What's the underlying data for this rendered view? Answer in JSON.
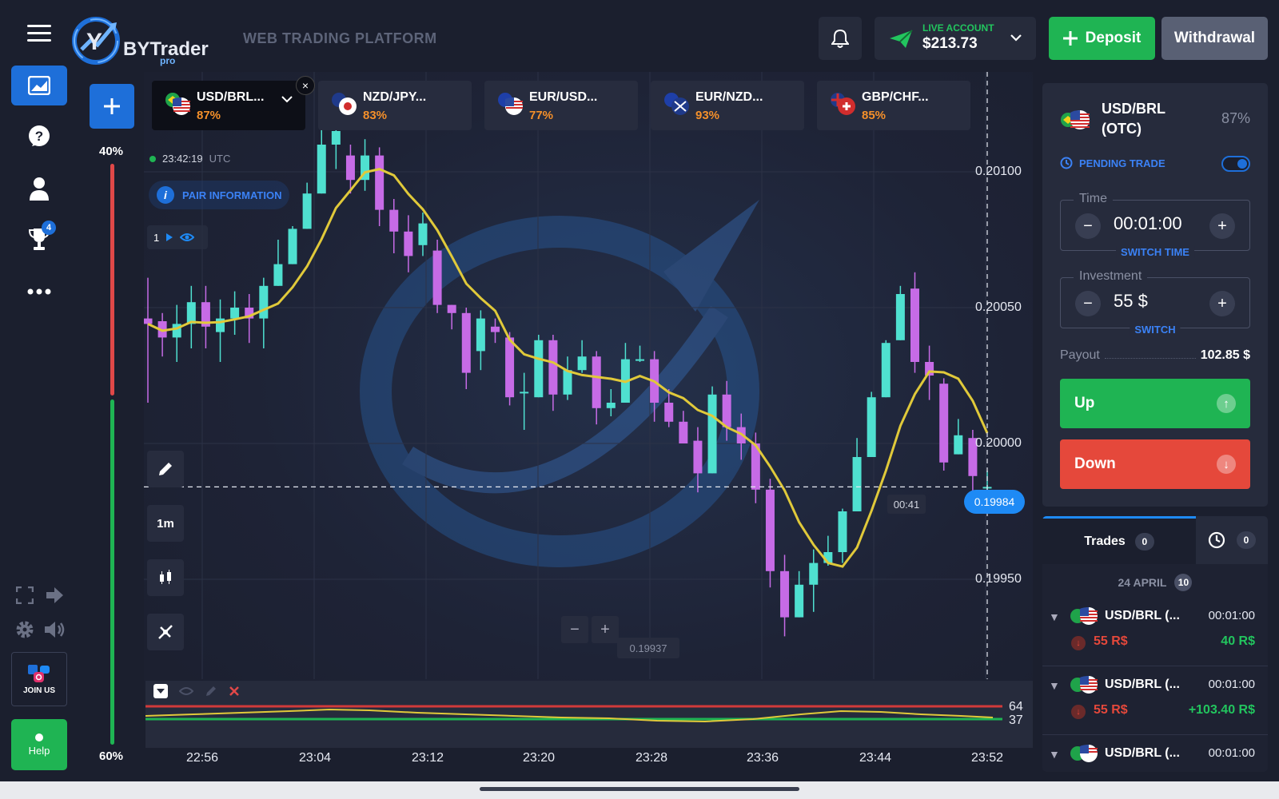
{
  "header": {
    "logo_text": "BYTrader",
    "logo_sub": "pro",
    "platform_title": "WEB TRADING PLATFORM",
    "account_label": "LIVE ACCOUNT",
    "balance": "$213.73",
    "deposit_label": "Deposit",
    "withdrawal_label": "Withdrawal"
  },
  "sidebar": {
    "trophy_badge": "4",
    "join_label": "JOIN US",
    "help_label": "Help"
  },
  "sentiment": {
    "top": "40%",
    "bottom": "60%"
  },
  "tabs": [
    {
      "name": "USD/BRL...",
      "pct": "87%"
    },
    {
      "name": "NZD/JPY...",
      "pct": "83%"
    },
    {
      "name": "EUR/USD...",
      "pct": "77%"
    },
    {
      "name": "EUR/NZD...",
      "pct": "93%"
    },
    {
      "name": "GBP/CHF...",
      "pct": "85%"
    }
  ],
  "chart": {
    "time": "23:42:19",
    "tz": "UTC",
    "pair_info_label": "PAIR INFORMATION",
    "indicator_count": "1",
    "timeframe": "1m",
    "current_price": "0.19984",
    "countdown": "00:41",
    "low_price": "0.19937",
    "y_labels": [
      "0.20100",
      "0.20050",
      "0.20000",
      "0.19950"
    ],
    "x_labels": [
      "22:56",
      "23:04",
      "23:12",
      "23:20",
      "23:28",
      "23:36",
      "23:44",
      "23:52"
    ],
    "osc_high": "64",
    "osc_low": "37",
    "colors": {
      "bull": "#4fe0d0",
      "bear": "#c66be6",
      "ma": "#e0c93a"
    }
  },
  "chart_data": {
    "type": "candlestick",
    "x_labels": [
      "22:56",
      "23:04",
      "23:12",
      "23:20",
      "23:28",
      "23:36",
      "23:44",
      "23:52"
    ],
    "y_ticks": [
      0.201,
      0.2005,
      0.2,
      0.1995
    ],
    "candles": [
      [
        0.20046,
        0.20044,
        0.20061,
        0.20015
      ],
      [
        0.20045,
        0.20039,
        0.20048,
        0.20032
      ],
      [
        0.20039,
        0.20044,
        0.20051,
        0.2003
      ],
      [
        0.20044,
        0.20052,
        0.20058,
        0.20035
      ],
      [
        0.20052,
        0.20043,
        0.20058,
        0.20035
      ],
      [
        0.20041,
        0.20046,
        0.20053,
        0.2003
      ],
      [
        0.20046,
        0.2005,
        0.20056,
        0.2004
      ],
      [
        0.2005,
        0.20046,
        0.20055,
        0.20037
      ],
      [
        0.20046,
        0.20058,
        0.20061,
        0.20035
      ],
      [
        0.20058,
        0.20066,
        0.20075,
        0.20058
      ],
      [
        0.20066,
        0.20079,
        0.2008,
        0.20066
      ],
      [
        0.20079,
        0.20092,
        0.20096,
        0.20079
      ],
      [
        0.20092,
        0.2011,
        0.2012,
        0.20092
      ],
      [
        0.2011,
        0.20115,
        0.20128,
        0.20101
      ],
      [
        0.20106,
        0.20097,
        0.2011,
        0.20092
      ],
      [
        0.20097,
        0.20106,
        0.20112,
        0.20093
      ],
      [
        0.20106,
        0.20086,
        0.20109,
        0.2008
      ],
      [
        0.20086,
        0.20078,
        0.2009,
        0.2007
      ],
      [
        0.20078,
        0.20069,
        0.20084,
        0.20063
      ],
      [
        0.20073,
        0.20081,
        0.20085,
        0.20069
      ],
      [
        0.20071,
        0.20051,
        0.20075,
        0.20048
      ],
      [
        0.20051,
        0.20048,
        0.20051,
        0.20042
      ],
      [
        0.20048,
        0.20026,
        0.2005,
        0.2002
      ],
      [
        0.20034,
        0.20046,
        0.20049,
        0.20027
      ],
      [
        0.20043,
        0.20041,
        0.20046,
        0.20037
      ],
      [
        0.20039,
        0.20017,
        0.20041,
        0.20014
      ],
      [
        0.20019,
        0.20019,
        0.20026,
        0.20005
      ],
      [
        0.20017,
        0.20038,
        0.2004,
        0.20017
      ],
      [
        0.20038,
        0.20018,
        0.2004,
        0.20012
      ],
      [
        0.20018,
        0.20027,
        0.20032,
        0.20016
      ],
      [
        0.20027,
        0.20032,
        0.20038,
        0.20026
      ],
      [
        0.20032,
        0.20013,
        0.20034,
        0.20007
      ],
      [
        0.20013,
        0.20015,
        0.2002,
        0.2001
      ],
      [
        0.20015,
        0.20031,
        0.20037,
        0.20015
      ],
      [
        0.20031,
        0.20031,
        0.20036,
        0.2003
      ],
      [
        0.20031,
        0.20015,
        0.20034,
        0.20008
      ],
      [
        0.20015,
        0.20008,
        0.2002,
        0.20006
      ],
      [
        0.20008,
        0.2,
        0.20012,
        0.2
      ],
      [
        0.20001,
        0.19989,
        0.20006,
        0.19982
      ],
      [
        0.19989,
        0.20018,
        0.20021,
        0.19989
      ],
      [
        0.20018,
        0.20006,
        0.20023,
        0.20001
      ],
      [
        0.20006,
        0.2,
        0.20011,
        0.19994
      ],
      [
        0.2,
        0.19983,
        0.20004,
        0.19978
      ],
      [
        0.19983,
        0.19953,
        0.19987,
        0.19947
      ],
      [
        0.19953,
        0.19936,
        0.19959,
        0.19929
      ],
      [
        0.19936,
        0.19948,
        0.19953,
        0.19936
      ],
      [
        0.19948,
        0.19956,
        0.19961,
        0.19938
      ],
      [
        0.19956,
        0.1996,
        0.19966,
        0.19955
      ],
      [
        0.1996,
        0.19975,
        0.19976,
        0.19956
      ],
      [
        0.19975,
        0.19995,
        0.20002,
        0.19975
      ],
      [
        0.19995,
        0.20017,
        0.20019,
        0.19995
      ],
      [
        0.20017,
        0.20037,
        0.20038,
        0.20017
      ],
      [
        0.20038,
        0.20055,
        0.20058,
        0.20038
      ],
      [
        0.20057,
        0.2003,
        0.20063,
        0.20026
      ],
      [
        0.2003,
        0.20025,
        0.20036,
        0.20016
      ],
      [
        0.20022,
        0.19993,
        0.20024,
        0.1999
      ],
      [
        0.19996,
        0.20003,
        0.20009,
        0.19996
      ],
      [
        0.20002,
        0.19988,
        0.20005,
        0.1998
      ],
      [
        0.19984,
        0.19984,
        0.1999,
        0.1998
      ]
    ],
    "oscillator_levels": [
      64,
      37
    ]
  },
  "panel": {
    "pair": "USD/BRL",
    "otc": "(OTC)",
    "pct": "87%",
    "pending_label": "PENDING TRADE",
    "time_legend": "Time",
    "time_value": "00:01:00",
    "time_sub": "SWITCH TIME",
    "inv_legend": "Investment",
    "inv_value": "55 $",
    "inv_sub": "SWITCH",
    "payout_label": "Payout",
    "payout_value": "102.85 $",
    "up_label": "Up",
    "down_label": "Down"
  },
  "trades": {
    "tab_label": "Trades",
    "tab_count": "0",
    "history_count": "0",
    "date": "24 APRIL",
    "date_count": "10",
    "rows": [
      {
        "name": "USD/BRL (...",
        "time": "00:01:00",
        "inv": "55 R$",
        "res": "40 R$"
      },
      {
        "name": "USD/BRL (...",
        "time": "00:01:00",
        "inv": "55 R$",
        "res": "+103.40 R$"
      },
      {
        "name": "USD/BRL (...",
        "time": "00:01:00",
        "inv": "",
        "res": ""
      }
    ]
  }
}
